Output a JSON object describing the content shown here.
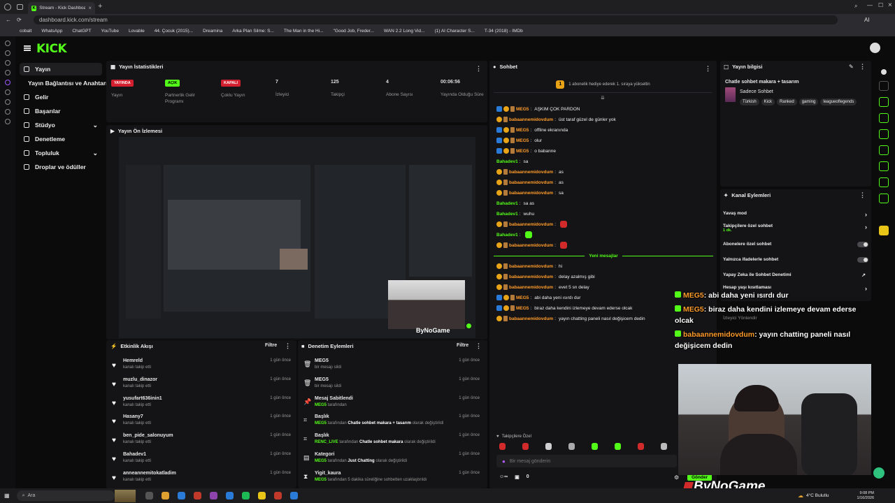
{
  "browser": {
    "tab_title": "Stream - Kick Dashboard",
    "url": "dashboard.kick.com/stream",
    "bookmarks": [
      "cobalt",
      "WhatsApp",
      "ChatGPT",
      "YouTube",
      "Lovable",
      "44. Çocuk (2015)...",
      "Dreamina",
      "Arka Plan Silme: S...",
      "The Man in the Hi...",
      "\"Good Job, Freder...",
      "WAN 2.2 Long Vid...",
      "(1) AI Character S...",
      "T-34 (2018) - IMDb"
    ],
    "ai_label": "AI"
  },
  "brand": {
    "logo": "KICK",
    "accent": "#53fc18"
  },
  "nav": {
    "items": [
      {
        "label": "Yayın",
        "icon": "broadcast-icon"
      },
      {
        "label": "Yayın Bağlantısı ve Anahtarı",
        "icon": "key-icon"
      },
      {
        "label": "Gelir",
        "icon": "money-icon"
      },
      {
        "label": "Başarılar",
        "icon": "trophy-icon"
      },
      {
        "label": "Stüdyo",
        "icon": "studio-icon"
      },
      {
        "label": "Denetleme",
        "icon": "shield-icon"
      },
      {
        "label": "Topluluk",
        "icon": "community-icon"
      },
      {
        "label": "Droplar ve ödüller",
        "icon": "gift-icon"
      }
    ]
  },
  "stats": {
    "title": "Yayın İstatistikleri",
    "items": [
      {
        "value": "YAYINDA",
        "label": "Yayın"
      },
      {
        "value": "AÇIK",
        "label": "Partnerlik Gelir Programı"
      },
      {
        "value": "KAPALI",
        "label": "Çoklu Yayın"
      },
      {
        "value": "7",
        "label": "İzleyici"
      },
      {
        "value": "125",
        "label": "Takipçi"
      },
      {
        "value": "4",
        "label": "Abone Sayısı"
      },
      {
        "value": "00:06:56",
        "label": "Yayında Olduğu Süre"
      }
    ]
  },
  "preview": {
    "title": "Yayın Ön İzlemesi"
  },
  "activity": {
    "title": "Etkinlik Akışı",
    "filter": "Filtre",
    "items": [
      {
        "name": "Hemreld",
        "sub": "kanalı takip etti",
        "time": "1 gün önce"
      },
      {
        "name": "muzlu_dinazor",
        "sub": "kanalı takip etti",
        "time": "1 gün önce"
      },
      {
        "name": "yusufart636inin1",
        "sub": "kanalı takip etti",
        "time": "1 gün önce"
      },
      {
        "name": "Hasany7",
        "sub": "kanalı takip etti",
        "time": "1 gün önce"
      },
      {
        "name": "ben_pide_salonuyum",
        "sub": "kanalı takip etti",
        "time": "1 gün önce"
      },
      {
        "name": "Bahadev1",
        "sub": "kanalı takip etti",
        "time": "1 gün önce"
      },
      {
        "name": "anneannemitokatladim",
        "sub": "kanalı takip etti",
        "time": "1 gün önce"
      }
    ]
  },
  "moderation": {
    "title": "Denetim Eylemleri",
    "filter": "Filtre",
    "items": [
      {
        "icon": "trash-icon",
        "name": "MEG5",
        "sub": "bir mesajı sildi",
        "time": "1 gün önce"
      },
      {
        "icon": "trash-icon",
        "name": "MEG5",
        "sub": "bir mesajı sildi",
        "time": "1 gün önce"
      },
      {
        "icon": "pin-icon",
        "name": "Mesaj Sabitlendi",
        "actor": "MEG5",
        "pre": "",
        "mid": " tarafından",
        "obj": "",
        "post": "",
        "time": "1 gün önce"
      },
      {
        "icon": "title-icon",
        "name": "Başlık",
        "actor": "MEG5",
        "mid": " tarafından ",
        "obj": "Chatle sohbet makara + tasarım",
        "post": " olarak değiştirildi",
        "time": "1 gün önce"
      },
      {
        "icon": "title-icon",
        "name": "Başlık",
        "actor": "RENC_LIVE",
        "mid": " tarafından ",
        "obj": "Chatle sohbet makara",
        "post": " olarak değiştirildi",
        "time": "1 gün önce"
      },
      {
        "icon": "category-icon",
        "name": "Kategori",
        "actor": "MEG5",
        "mid": " tarafından ",
        "obj": "Just Chatting",
        "post": " olarak değiştirildi",
        "time": "1 gün önce"
      },
      {
        "icon": "timeout-icon",
        "name": "Yigit_kaura",
        "actor": "MEG5",
        "mid": " tarafından 5 dakika süreliğine sohbetten uzaklaştırıldı",
        "obj": "",
        "post": "",
        "time": "1 gün önce"
      }
    ]
  },
  "chat": {
    "title": "Sohbet",
    "pinned": "1 abonelik hediye ederek 1. sıraya yükseltin",
    "messages": [
      {
        "user": "MEG5",
        "color": "org",
        "badges": "byc",
        "text": "AŞKIM ÇOK PARDON"
      },
      {
        "user": "babaannemidovdum",
        "color": "org",
        "badges": "yc",
        "text": "üst taraf güzel de günler yok"
      },
      {
        "user": "MEG5",
        "color": "org",
        "badges": "byc",
        "text": "offline ekranında"
      },
      {
        "user": "MEG5",
        "color": "org",
        "badges": "byc",
        "text": "olur"
      },
      {
        "user": "MEG5",
        "color": "org",
        "badges": "byc",
        "text": "o babanne"
      },
      {
        "user": "Bahadev1",
        "color": "grn",
        "badges": "",
        "text": "sa"
      },
      {
        "user": "babaannemidovdum",
        "color": "org",
        "badges": "yc",
        "text": "as"
      },
      {
        "user": "babaannemidovdum",
        "color": "org",
        "badges": "yc",
        "text": "as"
      },
      {
        "user": "babaannemidovdum",
        "color": "org",
        "badges": "yc",
        "text": "sa"
      },
      {
        "user": "Bahadev1",
        "color": "grn",
        "badges": "",
        "text": "sa as"
      },
      {
        "user": "Bahadev1",
        "color": "grn",
        "badges": "",
        "text": "wuhu"
      },
      {
        "user": "babaannemidovdum",
        "color": "org",
        "badges": "yc",
        "text": ""
      },
      {
        "user": "Bahadev1",
        "color": "grn",
        "badges": "",
        "text": ""
      },
      {
        "user": "babaannemidovdum",
        "color": "org",
        "badges": "yc",
        "text": ""
      }
    ],
    "new_label": "Yeni mesajlar",
    "new_messages": [
      {
        "user": "babaannemidovdum",
        "color": "org",
        "badges": "yc",
        "text": "hi"
      },
      {
        "user": "babaannemidovdum",
        "color": "org",
        "badges": "yc",
        "text": "delay azalmış gibi"
      },
      {
        "user": "babaannemidovdum",
        "color": "org",
        "badges": "yc",
        "text": "evet 5 sn delay"
      },
      {
        "user": "MEG5",
        "color": "org",
        "badges": "byc",
        "text": "abi daha yeni ısırdı dur"
      },
      {
        "user": "MEG5",
        "color": "org",
        "badges": "byc",
        "text": "biraz daha kendini izlemeye devam ederse olcak"
      },
      {
        "user": "babaannemidovdum",
        "color": "org",
        "badges": "yc",
        "text": "yayın chatting paneli nasıl değişicem dedin"
      }
    ],
    "mode": "Takipçilere Özel",
    "placeholder": "Bir mesaj gönderin",
    "count": "0",
    "send": "Gönder"
  },
  "stream_info": {
    "title": "Yayın bilgisi",
    "stream_title": "Chatle sohbet makara + tasarım",
    "category": "Sadece Sohbet",
    "tags": [
      "Türkish",
      "Kick",
      "Ranked",
      "gaming",
      "leagueoflegends"
    ]
  },
  "channel_actions": {
    "title": "Kanal Eylemleri",
    "items": [
      {
        "label": "Yavaş mod",
        "sub": "",
        "ctl": "chevron"
      },
      {
        "label": "Takipçilere özel sohbet",
        "sub": "1 dk.",
        "ctl": "chevron"
      },
      {
        "label": "Abonelere özel sohbet",
        "sub": "",
        "ctl": "toggle"
      },
      {
        "label": "Yalnızca ifadelerle sohbet",
        "sub": "",
        "ctl": "toggle"
      },
      {
        "label": "Yapay Zeka ile Sohbet Denetimi",
        "sub": "",
        "ctl": "link"
      },
      {
        "label": "Hesap yaşı kısıtlaması",
        "sub": "",
        "ctl": "chevron"
      }
    ]
  },
  "overlay": {
    "lines": [
      {
        "user": "MEG5",
        "text": ": abi daha yeni ısırdı dur"
      },
      {
        "user": "MEG5",
        "text": ": biraz daha kendini izlemeye devam ederse"
      },
      {
        "user": "",
        "text": "olcak"
      },
      {
        "user": "babaannemidovdum",
        "text": ": yayın chatting paneli nasıl"
      },
      {
        "user": "",
        "text": "değişicem dedin"
      }
    ],
    "ghost1": "İzleyici Yönlendir",
    "watermark": "ByNoGame",
    "preview_watermark": "ByNoGame"
  },
  "taskbar": {
    "search": "Ara",
    "weather": "4°C  Bulutlu",
    "time": "9:08 PM",
    "date": "1/16/2026"
  }
}
